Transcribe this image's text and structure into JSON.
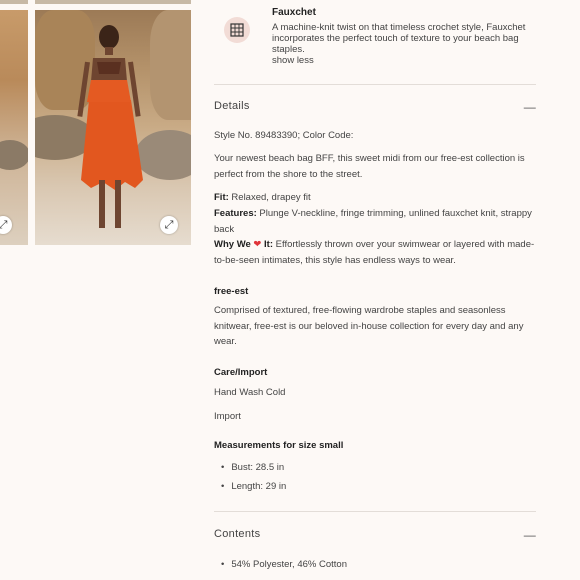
{
  "fabric": {
    "title": "Fauxchet",
    "description": "A machine-knit twist on that timeless crochet style, Fauxchet incorporates the perfect touch of texture to your beach bag staples.",
    "show_less": "show less"
  },
  "details": {
    "heading": "Details",
    "style_no": "Style No. 89483390; Color Code:",
    "intro": "Your newest beach bag BFF, this sweet midi from our free-est collection is perfect from the shore to the street.",
    "fit_label": "Fit:",
    "fit_value": " Relaxed, drapey fit",
    "features_label": "Features:",
    "features_value": " Plunge V-neckline, fringe trimming, unlined fauxchet knit, strappy back",
    "why_label_a": "Why We ",
    "why_heart": "❤",
    "why_label_b": " It:",
    "why_value": " Effortlessly thrown over your swimwear or layered with made-to-be-seen intimates, this style has endless ways to wear.",
    "free_est_heading": "free-est",
    "free_est_text": "Comprised of textured, free-flowing wardrobe staples and seasonless knitwear, free-est is our beloved in-house collection for every day and any wear.",
    "care_heading": "Care/Import",
    "care_wash": "Hand Wash Cold",
    "care_import": "Import",
    "measurements_heading": "Measurements for size small",
    "measurements": [
      "Bust: 28.5 in",
      "Length: 29 in"
    ]
  },
  "contents": {
    "heading": "Contents",
    "items": [
      "54% Polyester, 46% Cotton"
    ]
  },
  "toggle_symbol": "—",
  "icons": {
    "expand": "expand-icon",
    "fabric": "fabric-swatch-icon",
    "collapse": "minus-icon"
  }
}
